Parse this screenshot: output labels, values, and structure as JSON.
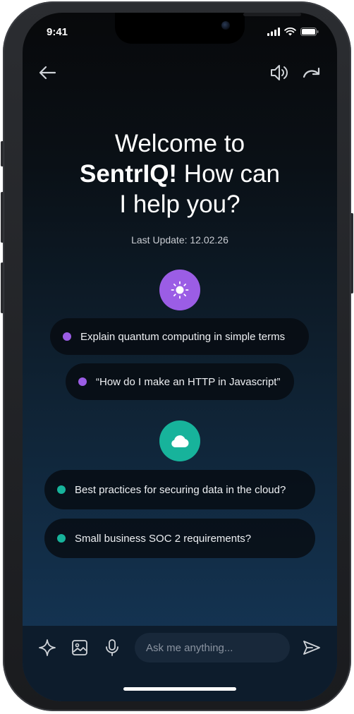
{
  "status_bar": {
    "time": "9:41",
    "icons": [
      "signal-icon",
      "wifi-icon",
      "battery-icon"
    ]
  },
  "top_bar": {
    "icons": [
      "back-arrow-icon",
      "speaker-icon",
      "redo-icon"
    ]
  },
  "header": {
    "title_line1": "Welcome to",
    "brand": "SentrIQ!",
    "title_line2_rest": " How can",
    "title_line3": "I help you?",
    "last_update": "Last Update: 12.02.26"
  },
  "groups": [
    {
      "icon": "sun-icon",
      "color": "#9b5de5",
      "prompts": [
        "Explain quantum computing in simple terms",
        "“How do I make an HTTP in Javascript”"
      ]
    },
    {
      "icon": "cloud-icon",
      "color": "#17b39b",
      "prompts": [
        "Best practices for securing data in the cloud?",
        "Small business SOC 2 requirements?"
      ]
    }
  ],
  "composer": {
    "placeholder": "Ask me anything...",
    "icons": [
      "sparkle-icon",
      "image-icon",
      "microphone-icon",
      "send-icon"
    ]
  },
  "colors": {
    "accent_purple": "#9b5de5",
    "accent_teal": "#17b39b",
    "background_top": "#08090b",
    "background_bottom": "#15385a"
  }
}
